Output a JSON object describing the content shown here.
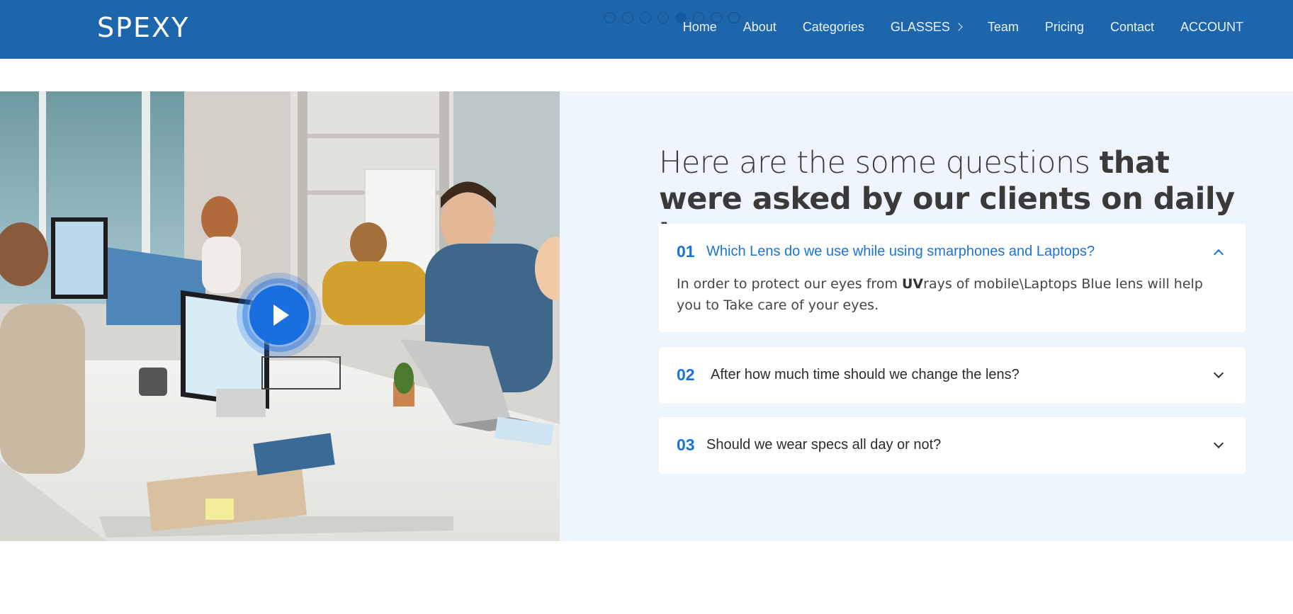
{
  "header": {
    "logo": "SPEXY",
    "slider_dots": [
      false,
      false,
      false,
      false,
      true,
      false,
      false,
      false
    ],
    "nav": [
      {
        "label": "Home"
      },
      {
        "label": "About"
      },
      {
        "label": "Categories"
      },
      {
        "label": "GLASSES",
        "has_submenu": true
      },
      {
        "label": "Team"
      },
      {
        "label": "Pricing"
      },
      {
        "label": "Contact"
      },
      {
        "label": "ACCOUNT"
      }
    ],
    "bg_color": "#1e66ab"
  },
  "hero": {
    "image_description_icon": "office-photo",
    "play_button_icon": "play-icon"
  },
  "faq": {
    "title_light": "Here are the some questions ",
    "title_bold": "that were asked by our clients on daily bases.",
    "items": [
      {
        "num": "01",
        "question": "Which Lens do we use while using smarphones and Laptops?",
        "expanded": true,
        "answer_before": "In order to protect our eyes from ",
        "answer_bold": "UV",
        "answer_after": "rays of mobile\\Laptops Blue lens will help you to Take care of your eyes."
      },
      {
        "num": "02",
        "question": "After how much time should we change the lens?",
        "expanded": false
      },
      {
        "num": "03",
        "question": "Should we wear specs all day or not?",
        "expanded": false
      }
    ],
    "accent_color": "#1a73d6"
  }
}
